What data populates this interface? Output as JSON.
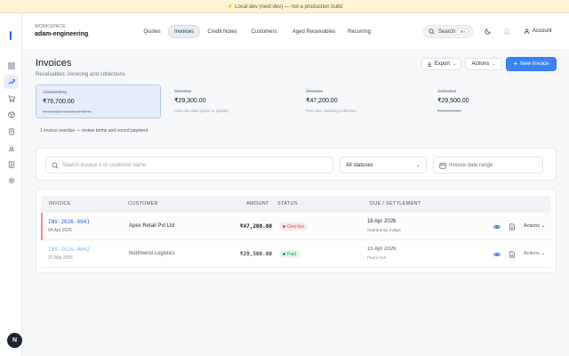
{
  "devbar": {
    "text": "⚡ Local dev (next dev) — not a production build"
  },
  "workspace": {
    "label": "WORKSPACE",
    "name": "adam-engineering"
  },
  "nav": {
    "tabs": [
      {
        "label": "Quotes"
      },
      {
        "label": "Invoices",
        "active": true
      },
      {
        "label": "Credit Notes"
      },
      {
        "label": "Customers"
      },
      {
        "label": "Aged Receivables"
      },
      {
        "label": "Recurring"
      }
    ]
  },
  "topbar": {
    "search_label": "Search",
    "search_shortcut": "⌘K",
    "account_label": "Account"
  },
  "sidebar": {
    "avatar_initial": "N"
  },
  "page": {
    "title": "Invoices",
    "subtitle": "Receivables: invoicing and collections",
    "export_label": "Export",
    "actions_label": "Actions",
    "new_label": "New invoice"
  },
  "kpis": [
    {
      "label": "Outstanding",
      "value": "₹76,700.00",
      "note": "Receivable across all filters",
      "active": true
    },
    {
      "label": "Overdue",
      "value": "₹29,300.00",
      "note": "Past due date (open or partial)"
    },
    {
      "label": "Overdue",
      "value": "₹47,200.00",
      "note": "Past due, awaiting collection"
    },
    {
      "label": "Collected",
      "value": "₹29,500.00",
      "note": "Paid invoices"
    }
  ],
  "overdue_note": "1 invoice overdue — review terms and record payment.",
  "filters": {
    "search_placeholder": "Search invoice # or customer name",
    "status_value": "All statuses",
    "date_placeholder": "Invoice date range"
  },
  "table": {
    "headers": {
      "invoice": "INVOICE",
      "customer": "CUSTOMER",
      "amount": "AMOUNT",
      "status": "STATUS",
      "due": "DUE / SETTLEMENT"
    },
    "rows": [
      {
        "number": "INV-2026-0041",
        "date": "04 Apr 2026",
        "customer": "Apex Retail Pvt Ltd",
        "amount": "₹47,200.00",
        "status": "Overdue",
        "due_date": "18 Apr 2026",
        "due_note": "Overdue by 3 days",
        "actions": "Actions"
      },
      {
        "number": "INV-2026-0042",
        "date": "31 Mar 2026",
        "customer": "Northwind Logistics",
        "amount": "₹29,500.00",
        "status": "Paid",
        "due_date": "15 Apr 2026",
        "due_note": "Paid in full",
        "actions": "Actions"
      }
    ]
  },
  "colors": {
    "accent": "#3b82f6",
    "overdue": "#e5484d",
    "paid": "#16a34a",
    "devbar_bg": "#fdf3d7"
  }
}
